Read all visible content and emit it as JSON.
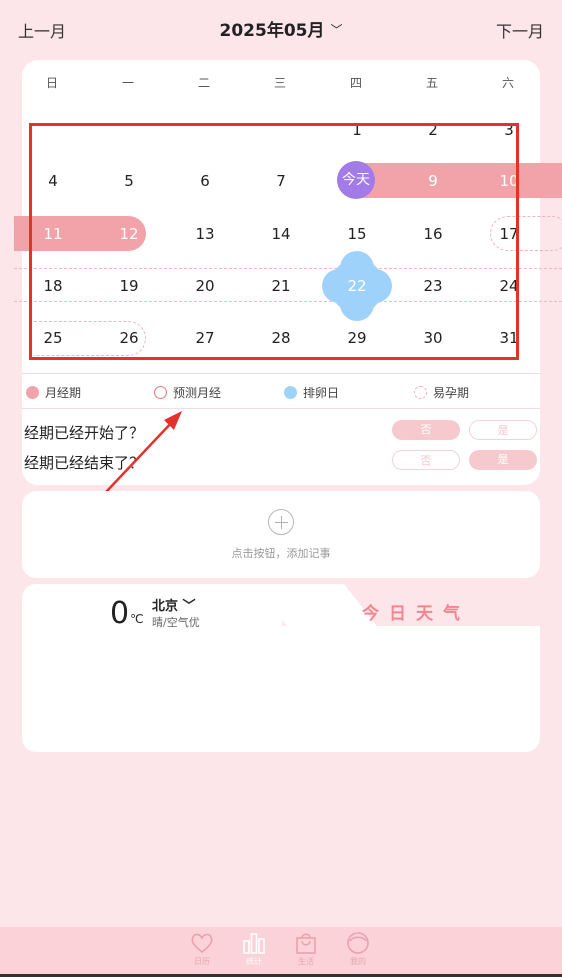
{
  "header": {
    "prev": "上一月",
    "month": "2025年05月",
    "next": "下一月"
  },
  "weekdays": [
    "日",
    "一",
    "二",
    "三",
    "四",
    "五",
    "六"
  ],
  "today_label": "今天",
  "weeks": [
    [
      "",
      "",
      "",
      "",
      "1",
      "2",
      "3"
    ],
    [
      "4",
      "5",
      "6",
      "7",
      "",
      "9",
      "10"
    ],
    [
      "11",
      "12",
      "13",
      "14",
      "15",
      "16",
      "17"
    ],
    [
      "18",
      "19",
      "20",
      "21",
      "22",
      "23",
      "24"
    ],
    [
      "25",
      "26",
      "27",
      "28",
      "29",
      "30",
      "31"
    ]
  ],
  "legend": {
    "period": "月经期",
    "predicted": "预测月经",
    "ovulation": "排卵日",
    "fertile": "易孕期"
  },
  "questions": {
    "started": "经期已经开始了？",
    "ended": "经期已经结束了？",
    "no": "否",
    "yes": "是"
  },
  "memo": {
    "hint": "点击按钮，添加记事"
  },
  "weather": {
    "temp": "0",
    "unit": "℃",
    "city": "北京",
    "condition": "晴/空气优",
    "title": "今日天气"
  },
  "tabs": [
    "日历",
    "统计",
    "生活",
    "我的"
  ],
  "colors": {
    "period": "#f2a3aa",
    "today": "#a27be8",
    "ovulation": "#9fd2fb",
    "accent": "#f2858f"
  }
}
